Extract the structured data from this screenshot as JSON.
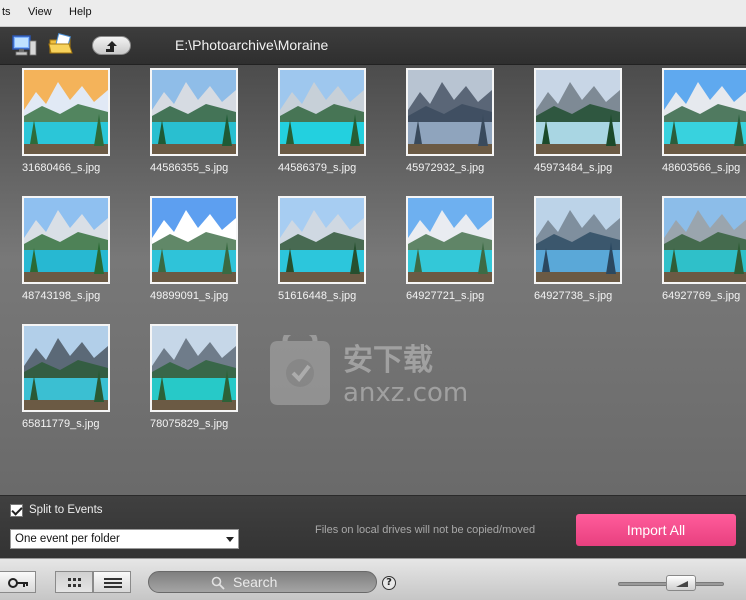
{
  "menu": {
    "items": [
      "ts",
      "View",
      "Help"
    ]
  },
  "toolbar": {
    "path": "E:\\Photoarchive\\Moraine",
    "icons": [
      "computer-icon",
      "folder-icon",
      "up-arrow-icon"
    ]
  },
  "gallery": {
    "thumbnails": [
      {
        "name": "31680466_s.jpg"
      },
      {
        "name": "44586355_s.jpg"
      },
      {
        "name": "44586379_s.jpg"
      },
      {
        "name": "45972932_s.jpg"
      },
      {
        "name": "45973484_s.jpg"
      },
      {
        "name": "48603566_s.jpg"
      },
      {
        "name": "48743198_s.jpg"
      },
      {
        "name": "49899091_s.jpg"
      },
      {
        "name": "51616448_s.jpg"
      },
      {
        "name": "64927721_s.jpg"
      },
      {
        "name": "64927738_s.jpg"
      },
      {
        "name": "64927769_s.jpg"
      },
      {
        "name": "65811779_s.jpg"
      },
      {
        "name": "78075829_s.jpg"
      }
    ]
  },
  "watermark": {
    "text_cn": "安下载",
    "text_url": "anxz.com"
  },
  "options": {
    "split_label": "Split to Events",
    "split_checked": true,
    "select_value": "One event per folder",
    "note": "Files on local drives will not be copied/moved",
    "import_label": "Import All"
  },
  "statusbar": {
    "search_placeholder": "Search",
    "help_label": "?",
    "zoom_level": 0.45
  },
  "colors": {
    "accent": "#f0498a",
    "water": "#2ec4d6",
    "sky": "#6fb2ea"
  }
}
